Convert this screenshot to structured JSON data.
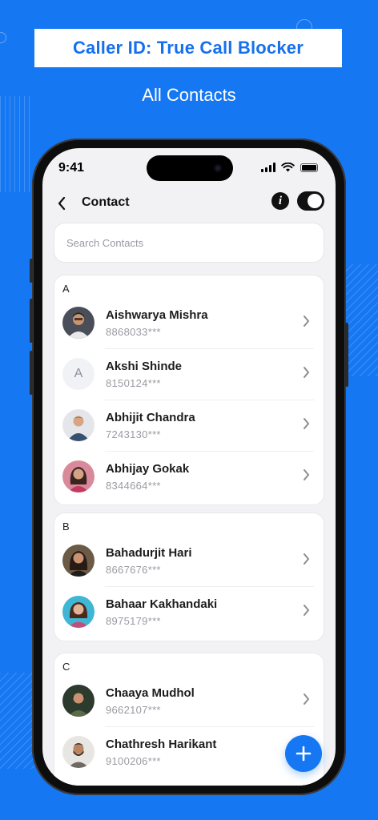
{
  "banner": {
    "title": "Caller ID: True Call Blocker"
  },
  "subtitle": "All Contacts",
  "status_bar": {
    "time": "9:41"
  },
  "header": {
    "title": "Contact",
    "info_icon": "info-icon",
    "toggle_state": "on"
  },
  "search": {
    "placeholder": "Search Contacts",
    "value": ""
  },
  "sections": [
    {
      "letter": "A",
      "contacts": [
        {
          "name": "Aishwarya Mishra",
          "number": "8868033***",
          "avatar": "photo"
        },
        {
          "name": "Akshi Shinde",
          "number": "8150124***",
          "avatar": "initial",
          "initial": "A"
        },
        {
          "name": "Abhijit Chandra",
          "number": "7243130***",
          "avatar": "photo"
        },
        {
          "name": "Abhijay Gokak",
          "number": "8344664***",
          "avatar": "photo"
        }
      ]
    },
    {
      "letter": "B",
      "contacts": [
        {
          "name": "Bahadurjit Hari",
          "number": "8667676***",
          "avatar": "photo"
        },
        {
          "name": "Bahaar Kakhandaki",
          "number": "8975179***",
          "avatar": "photo"
        }
      ]
    },
    {
      "letter": "C",
      "contacts": [
        {
          "name": "Chaaya Mudhol",
          "number": "9662107***",
          "avatar": "photo"
        },
        {
          "name": "Chathresh Harikant",
          "number": "9100206***",
          "avatar": "photo"
        }
      ]
    }
  ],
  "fab": {
    "icon": "plus-icon"
  },
  "colors": {
    "brand": "#1677f2",
    "background": "#f2f2f4",
    "text": "#1d1d1f"
  }
}
